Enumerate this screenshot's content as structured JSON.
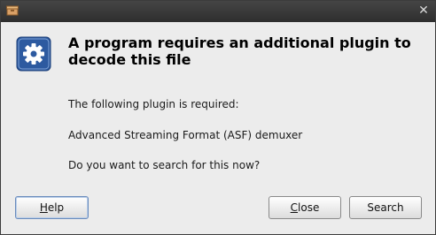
{
  "window": {
    "title": ""
  },
  "dialog": {
    "heading": "A program requires an additional plugin to decode this file",
    "line1": "The following plugin is required:",
    "plugin": "Advanced Streaming Format (ASF) demuxer",
    "question": "Do you want to search for this now?"
  },
  "buttons": {
    "help_mnemonic": "H",
    "help_rest": "elp",
    "close_mnemonic": "C",
    "close_rest": "lose",
    "search_label": "Search"
  },
  "icons": {
    "app": "package-icon",
    "dialog": "gear-icon",
    "close": "close-icon"
  },
  "colors": {
    "dialog_icon": "#2d5aa0",
    "titlebar": "#3a3a3a",
    "app_icon": "#d9a066"
  }
}
